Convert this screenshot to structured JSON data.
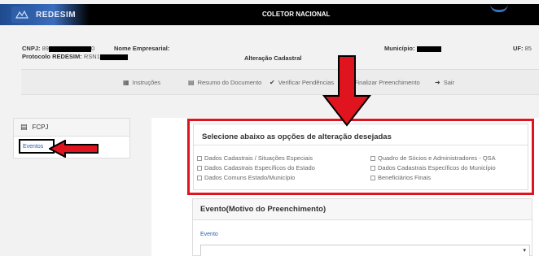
{
  "topbar": {
    "brand": "REDESIM",
    "title": "COLETOR NACIONAL"
  },
  "header": {
    "cnpj_label": "CNPJ:",
    "cnpj_value_prefix": "89",
    "cnpj_value_suffix": "0",
    "nome_label": "Nome Empresarial:",
    "protocolo_label": "Protocolo REDESIM:",
    "protocolo_value_prefix": "RSN1",
    "municipio_label": "Município:",
    "uf_label": "UF:",
    "uf_value": "85",
    "subtitle": "Alteração Cadastral"
  },
  "toolbar": {
    "items": [
      {
        "label": "Instruções",
        "icon": "book-icon"
      },
      {
        "label": "Resumo do Documento",
        "icon": "document-icon"
      },
      {
        "label": "Verificar Pendências",
        "icon": "check-circle-icon"
      },
      {
        "label": "Finalizar Preenchimento",
        "icon": "finish-icon"
      },
      {
        "label": "Sair",
        "icon": "logout-icon"
      }
    ]
  },
  "leftpanel": {
    "title": "FCPJ",
    "link": "Eventos"
  },
  "selection": {
    "title": "Selecione abaixo as opções de alteração desejadas",
    "options_left": [
      "Dados Cadastrais / Situações Especiais",
      "Dados Cadastrais Específicos do Estado",
      "Dados Comuns Estado/Município"
    ],
    "options_right": [
      "Quadro de Sócios e Administradores - QSA",
      "Dados Cadastrais Específicos do Município",
      "Beneficiários Finais"
    ]
  },
  "evento": {
    "title": "Evento(Motivo do Preenchimento)",
    "field_label": "Evento"
  },
  "colors": {
    "highlight": "#e0141e",
    "link": "#2a5db0",
    "topbar": "#000000"
  }
}
